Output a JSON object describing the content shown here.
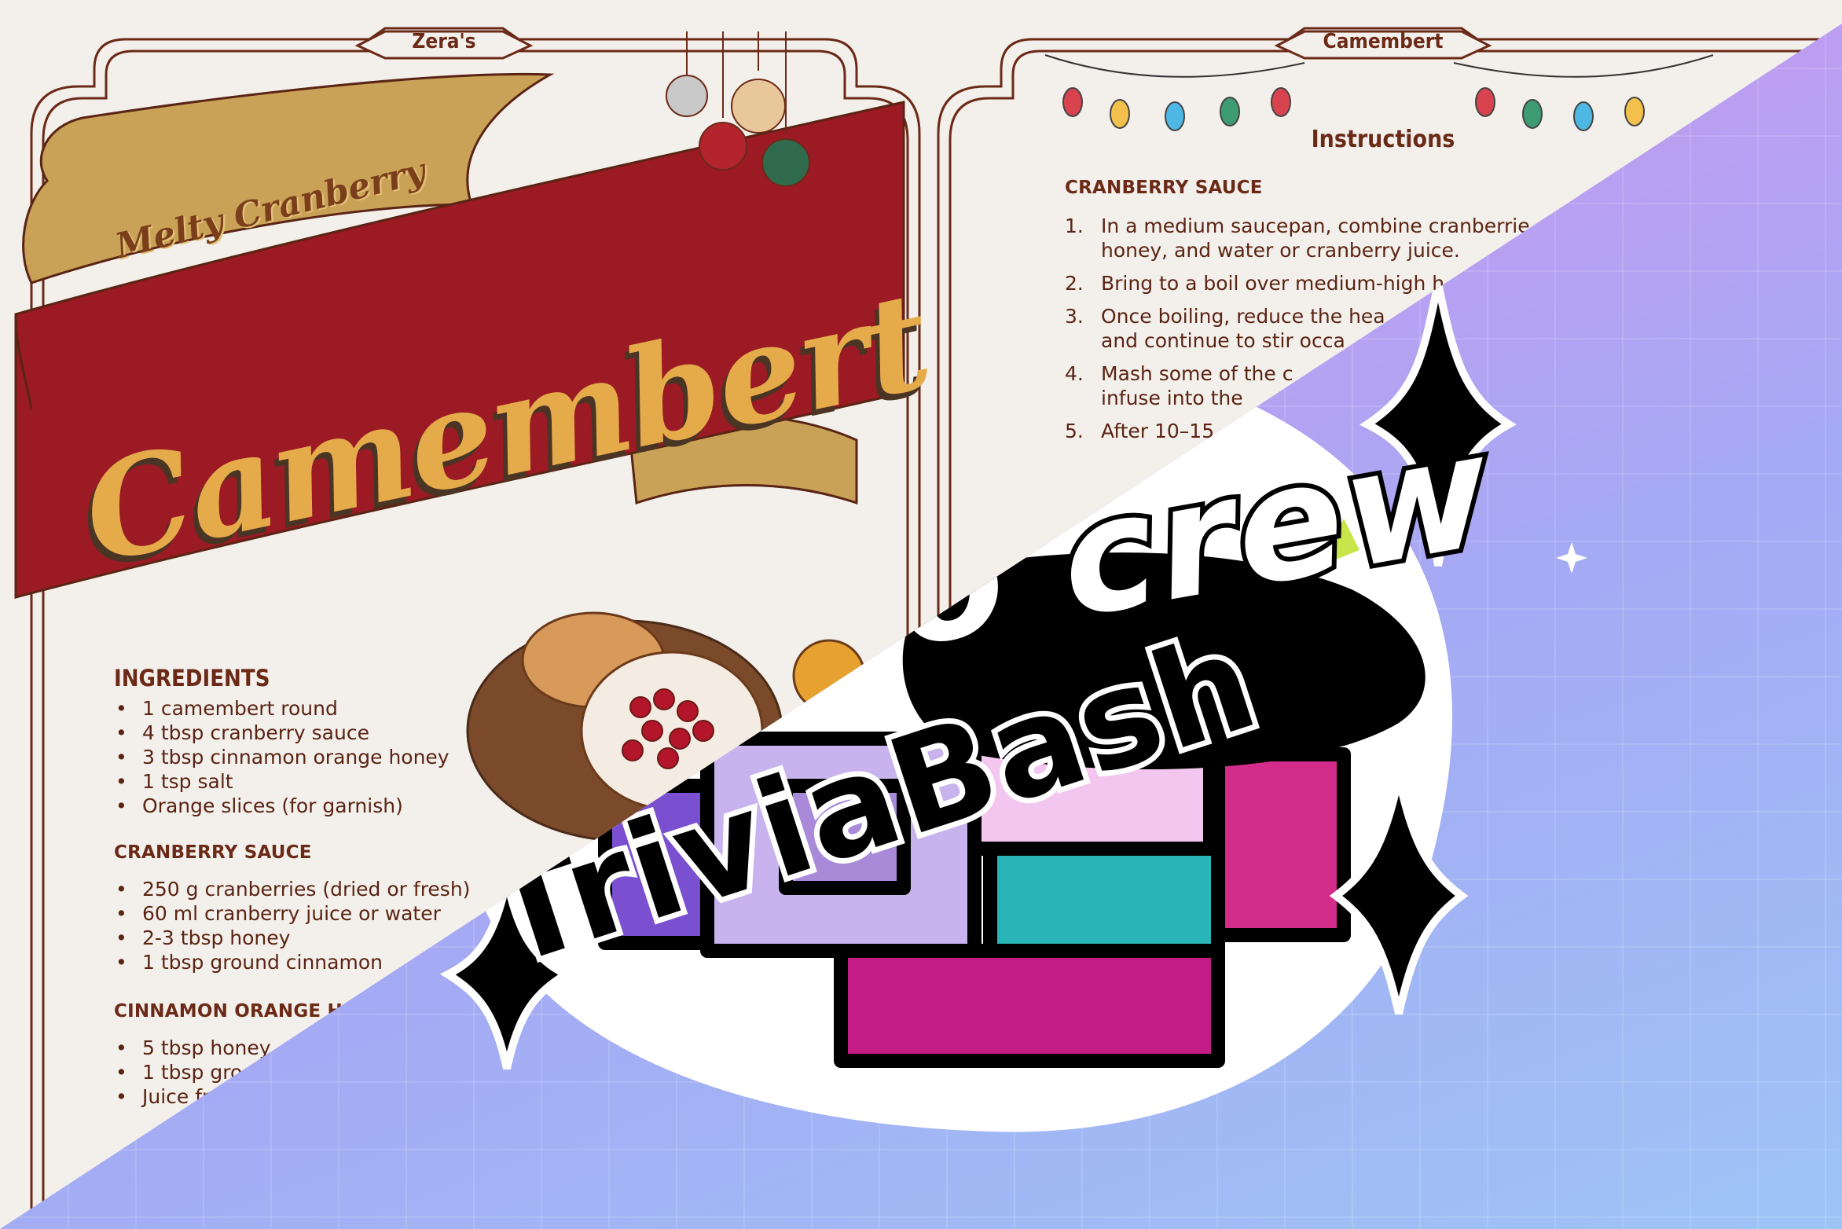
{
  "left_page": {
    "tab_label": "Zera's",
    "banner_small": "Melty Cranberry",
    "banner_big": "Camembert",
    "ingredients_heading": "INGREDIENTS",
    "ingredients": [
      "1 camembert round",
      "4 tbsp cranberry sauce",
      "3 tbsp cinnamon orange honey",
      "1 tsp salt",
      "Orange slices (for garnish)"
    ],
    "sauce_heading": "CRANBERRY SAUCE",
    "sauce_items": [
      "250 g cranberries (dried or fresh)",
      "60 ml cranberry juice or water",
      "2-3 tbsp honey",
      "1 tbsp ground cinnamon"
    ],
    "honey_heading": "CINNAMON ORANGE H",
    "honey_items": [
      "5 tbsp honey",
      "1 tbsp gro",
      "Juice fr"
    ]
  },
  "right_page": {
    "tab_label": "Camembert",
    "instructions_heading": "Instructions",
    "sauce_heading": "CRANBERRY SAUCE",
    "steps": [
      {
        "num": "1.",
        "text": "In a medium saucepan, combine cranberrie\nhoney, and water or cranberry juice."
      },
      {
        "num": "2.",
        "text": "Bring to a boil over medium-high h"
      },
      {
        "num": "3.",
        "text": "Once boiling, reduce the hea\nand continue to stir occa"
      },
      {
        "num": "4.",
        "text": "Mash some of the c\ninfuse into the"
      },
      {
        "num": "5.",
        "text": "After 10–15"
      }
    ]
  },
  "overlay": {
    "logo_top": "o crew",
    "logo_bottom": "TriviaBash"
  },
  "colors": {
    "frame": "#6b2a18",
    "banner_red": "#9b1a24",
    "ribbon_gold": "#c9a258",
    "title_gold": "#e5ab4b",
    "overlay_pink": "#e69bef",
    "overlay_blue": "#9ec4f6"
  }
}
